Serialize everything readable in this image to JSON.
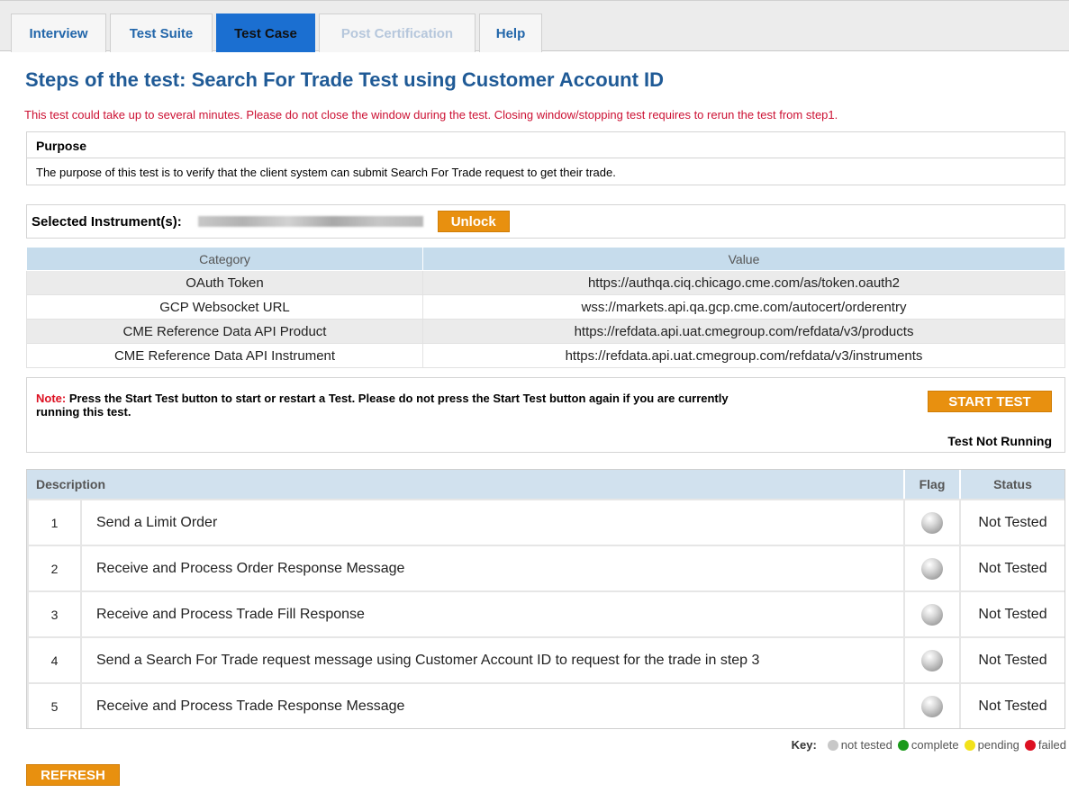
{
  "tabs": [
    {
      "label": "Interview"
    },
    {
      "label": "Test Suite"
    },
    {
      "label": "Test Case"
    },
    {
      "label": "Post Certification"
    },
    {
      "label": "Help"
    }
  ],
  "title": "Steps of the test: Search For Trade Test using Customer Account ID",
  "warning": "This test could take up to several minutes. Please do not close the window during the test. Closing window/stopping test requires to rerun the test from step1.",
  "purpose": {
    "heading": "Purpose",
    "text": "The purpose of this test is to verify that the client system can submit Search For Trade request to get their trade."
  },
  "instrument": {
    "label": "Selected Instrument(s):",
    "unlock_label": "Unlock"
  },
  "params": {
    "headers": [
      "Category",
      "Value"
    ],
    "rows": [
      [
        "OAuth Token",
        "https://authqa.ciq.chicago.cme.com/as/token.oauth2"
      ],
      [
        "GCP Websocket URL",
        "wss://markets.api.qa.gcp.cme.com/autocert/orderentry"
      ],
      [
        "CME Reference Data API Product",
        "https://refdata.api.uat.cmegroup.com/refdata/v3/products"
      ],
      [
        "CME Reference Data API Instrument",
        "https://refdata.api.uat.cmegroup.com/refdata/v3/instruments"
      ]
    ]
  },
  "note": {
    "prefix": "Note:",
    "text": " Press the Start Test button to start or restart a Test. Please do not press the Start Test button again if you are currently running this test."
  },
  "start_label": "START TEST",
  "test_state": "Test Not Running",
  "steps": {
    "headers": {
      "description": "Description",
      "flag": "Flag",
      "status": "Status"
    },
    "rows": [
      {
        "num": "1",
        "desc": "Send a Limit Order",
        "status": "Not Tested"
      },
      {
        "num": "2",
        "desc": "Receive and Process Order Response Message",
        "status": "Not Tested"
      },
      {
        "num": "3",
        "desc": "Receive and Process Trade Fill Response",
        "status": "Not Tested"
      },
      {
        "num": "4",
        "desc": "Send a Search For Trade request message using Customer Account ID to request for the trade in step 3",
        "status": "Not Tested"
      },
      {
        "num": "5",
        "desc": "Receive and Process Trade Response Message",
        "status": "Not Tested"
      }
    ]
  },
  "key": {
    "label": "Key:",
    "items": [
      {
        "label": "not tested",
        "color": "#c8c8c8"
      },
      {
        "label": "complete",
        "color": "#1a9a1a"
      },
      {
        "label": "pending",
        "color": "#f2e21a"
      },
      {
        "label": "failed",
        "color": "#dd1122"
      }
    ]
  },
  "refresh_label": "REFRESH",
  "colors": {
    "accent": "#1b6fd1",
    "title": "#1f5a96",
    "button": "#e8900f",
    "warning": "#cc1133"
  }
}
